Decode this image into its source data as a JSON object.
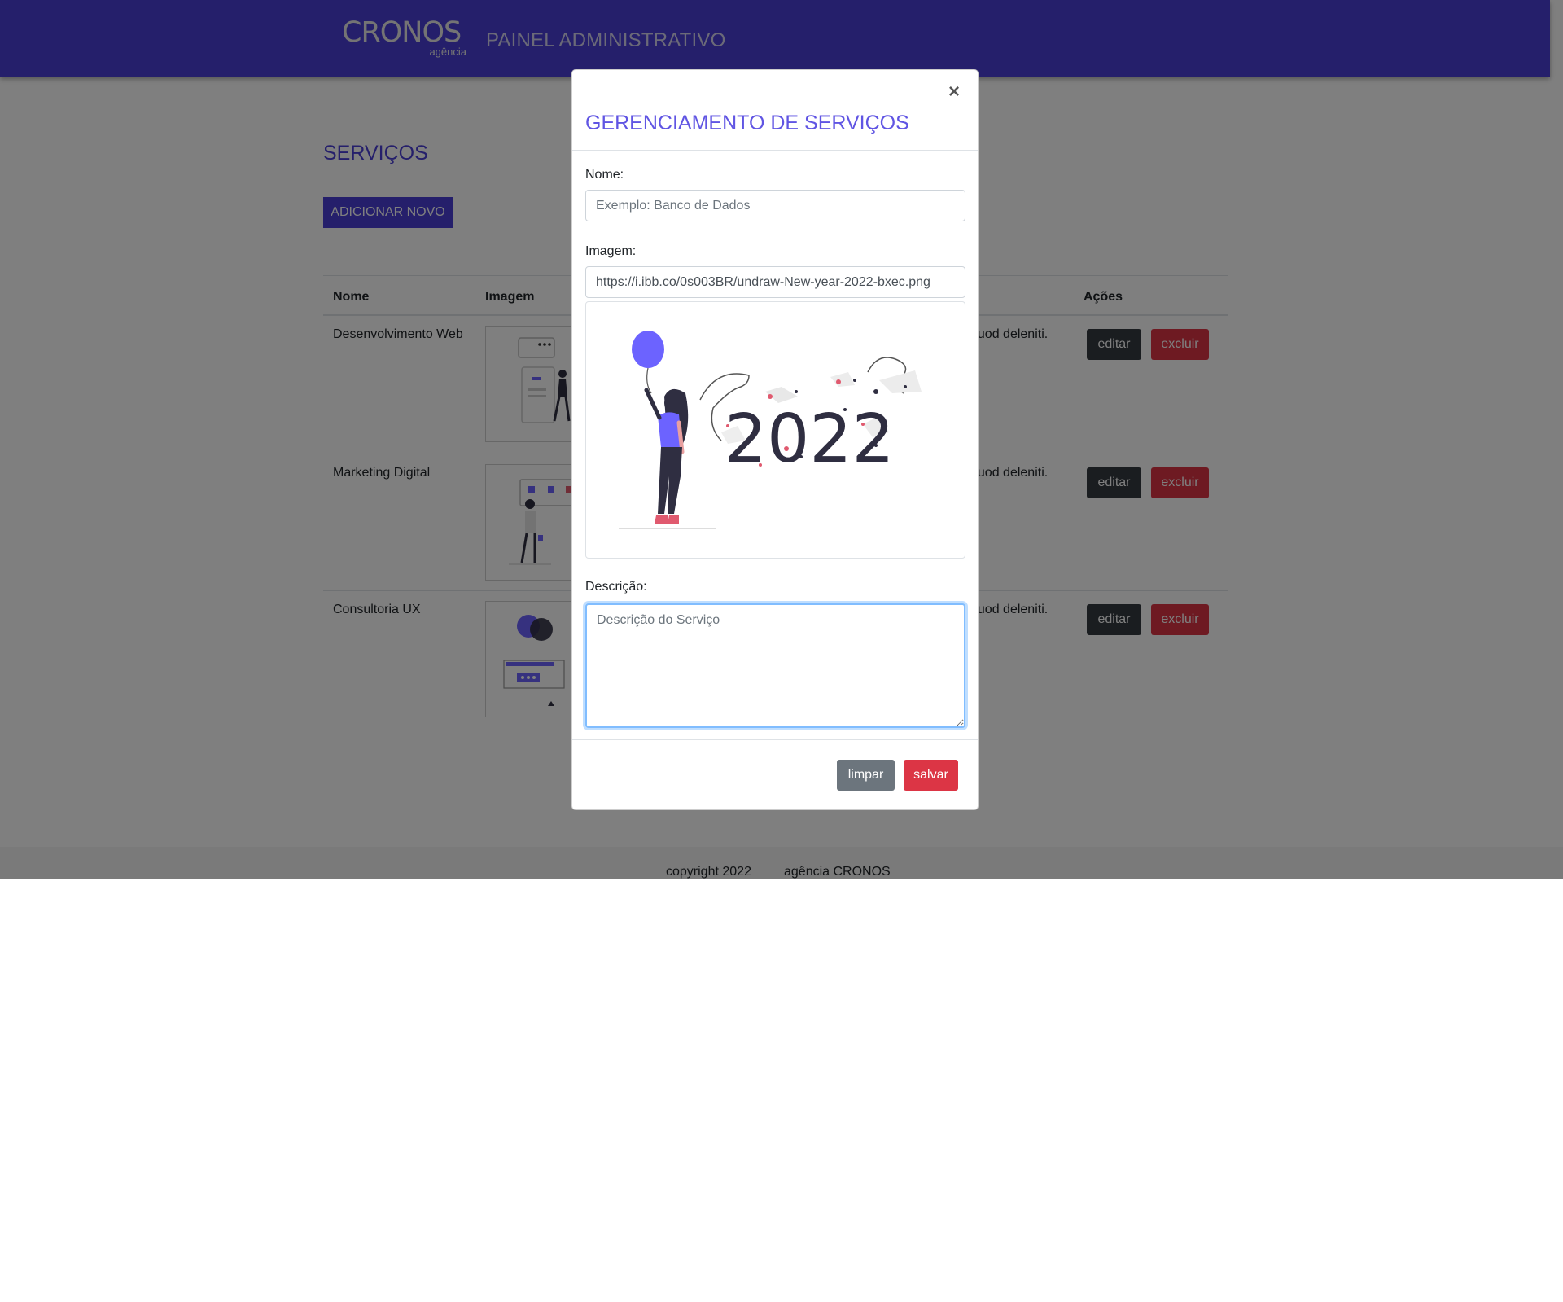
{
  "header": {
    "brand_name": "CRONOS",
    "brand_sub": "agência",
    "panel_title": "PAINEL ADMINISTRATIVO"
  },
  "main": {
    "section_title": "SERVIÇOS",
    "add_button": "ADICIONAR NOVO",
    "table": {
      "columns": {
        "name": "Nome",
        "image": "Imagem",
        "actions": "Ações"
      },
      "rows": [
        {
          "name": "Desenvolvimento Web",
          "desc_tail": "quod deleniti.",
          "edit": "editar",
          "delete": "excluir"
        },
        {
          "name": "Marketing Digital",
          "desc_tail": "quod deleniti.",
          "edit": "editar",
          "delete": "excluir"
        },
        {
          "name": "Consultoria UX",
          "desc_tail": "quod deleniti.",
          "edit": "editar",
          "delete": "excluir"
        }
      ]
    }
  },
  "footer": {
    "copyright": "copyright 2022",
    "agency": "agência CRONOS"
  },
  "modal": {
    "close": "×",
    "title": "GERENCIAMENTO DE SERVIÇOS",
    "name_label": "Nome:",
    "name_placeholder": "Exemplo: Banco de Dados",
    "image_label": "Imagem:",
    "image_value": "https://i.ibb.co/0s003BR/undraw-New-year-2022-bxec.png",
    "preview_text": "2022",
    "desc_label": "Descrição:",
    "desc_placeholder": "Descrição do Serviço",
    "clear_button": "limpar",
    "save_button": "salvar"
  },
  "colors": {
    "brand": "#4b3fd6",
    "modal_title": "#6055e3",
    "danger": "#dc3545",
    "dark": "#343a40",
    "secondary": "#6c757d"
  }
}
